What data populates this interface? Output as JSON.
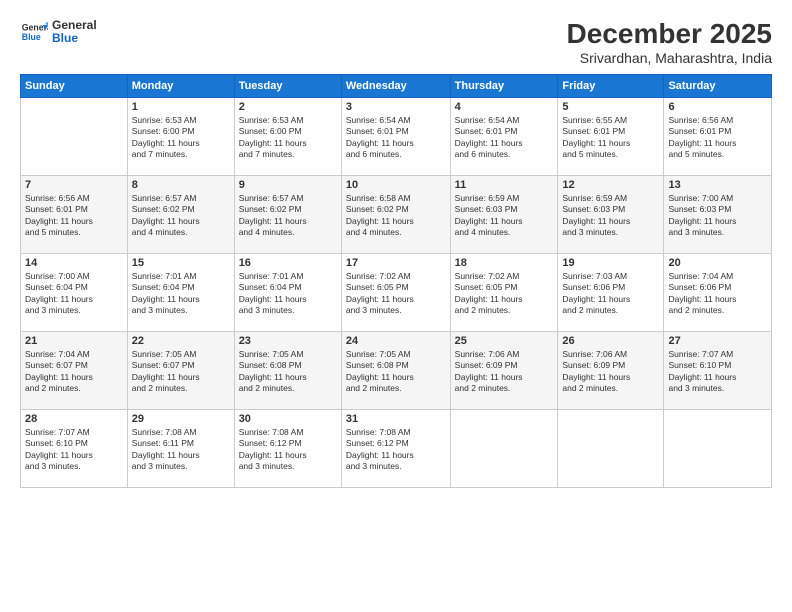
{
  "logo": {
    "line1": "General",
    "line2": "Blue"
  },
  "title": "December 2025",
  "subtitle": "Srivardhan, Maharashtra, India",
  "days_of_week": [
    "Sunday",
    "Monday",
    "Tuesday",
    "Wednesday",
    "Thursday",
    "Friday",
    "Saturday"
  ],
  "weeks": [
    [
      {
        "day": "",
        "info": ""
      },
      {
        "day": "1",
        "info": "Sunrise: 6:53 AM\nSunset: 6:00 PM\nDaylight: 11 hours\nand 7 minutes."
      },
      {
        "day": "2",
        "info": "Sunrise: 6:53 AM\nSunset: 6:00 PM\nDaylight: 11 hours\nand 7 minutes."
      },
      {
        "day": "3",
        "info": "Sunrise: 6:54 AM\nSunset: 6:01 PM\nDaylight: 11 hours\nand 6 minutes."
      },
      {
        "day": "4",
        "info": "Sunrise: 6:54 AM\nSunset: 6:01 PM\nDaylight: 11 hours\nand 6 minutes."
      },
      {
        "day": "5",
        "info": "Sunrise: 6:55 AM\nSunset: 6:01 PM\nDaylight: 11 hours\nand 5 minutes."
      },
      {
        "day": "6",
        "info": "Sunrise: 6:56 AM\nSunset: 6:01 PM\nDaylight: 11 hours\nand 5 minutes."
      }
    ],
    [
      {
        "day": "7",
        "info": "Sunrise: 6:56 AM\nSunset: 6:01 PM\nDaylight: 11 hours\nand 5 minutes."
      },
      {
        "day": "8",
        "info": "Sunrise: 6:57 AM\nSunset: 6:02 PM\nDaylight: 11 hours\nand 4 minutes."
      },
      {
        "day": "9",
        "info": "Sunrise: 6:57 AM\nSunset: 6:02 PM\nDaylight: 11 hours\nand 4 minutes."
      },
      {
        "day": "10",
        "info": "Sunrise: 6:58 AM\nSunset: 6:02 PM\nDaylight: 11 hours\nand 4 minutes."
      },
      {
        "day": "11",
        "info": "Sunrise: 6:59 AM\nSunset: 6:03 PM\nDaylight: 11 hours\nand 4 minutes."
      },
      {
        "day": "12",
        "info": "Sunrise: 6:59 AM\nSunset: 6:03 PM\nDaylight: 11 hours\nand 3 minutes."
      },
      {
        "day": "13",
        "info": "Sunrise: 7:00 AM\nSunset: 6:03 PM\nDaylight: 11 hours\nand 3 minutes."
      }
    ],
    [
      {
        "day": "14",
        "info": "Sunrise: 7:00 AM\nSunset: 6:04 PM\nDaylight: 11 hours\nand 3 minutes."
      },
      {
        "day": "15",
        "info": "Sunrise: 7:01 AM\nSunset: 6:04 PM\nDaylight: 11 hours\nand 3 minutes."
      },
      {
        "day": "16",
        "info": "Sunrise: 7:01 AM\nSunset: 6:04 PM\nDaylight: 11 hours\nand 3 minutes."
      },
      {
        "day": "17",
        "info": "Sunrise: 7:02 AM\nSunset: 6:05 PM\nDaylight: 11 hours\nand 3 minutes."
      },
      {
        "day": "18",
        "info": "Sunrise: 7:02 AM\nSunset: 6:05 PM\nDaylight: 11 hours\nand 2 minutes."
      },
      {
        "day": "19",
        "info": "Sunrise: 7:03 AM\nSunset: 6:06 PM\nDaylight: 11 hours\nand 2 minutes."
      },
      {
        "day": "20",
        "info": "Sunrise: 7:04 AM\nSunset: 6:06 PM\nDaylight: 11 hours\nand 2 minutes."
      }
    ],
    [
      {
        "day": "21",
        "info": "Sunrise: 7:04 AM\nSunset: 6:07 PM\nDaylight: 11 hours\nand 2 minutes."
      },
      {
        "day": "22",
        "info": "Sunrise: 7:05 AM\nSunset: 6:07 PM\nDaylight: 11 hours\nand 2 minutes."
      },
      {
        "day": "23",
        "info": "Sunrise: 7:05 AM\nSunset: 6:08 PM\nDaylight: 11 hours\nand 2 minutes."
      },
      {
        "day": "24",
        "info": "Sunrise: 7:05 AM\nSunset: 6:08 PM\nDaylight: 11 hours\nand 2 minutes."
      },
      {
        "day": "25",
        "info": "Sunrise: 7:06 AM\nSunset: 6:09 PM\nDaylight: 11 hours\nand 2 minutes."
      },
      {
        "day": "26",
        "info": "Sunrise: 7:06 AM\nSunset: 6:09 PM\nDaylight: 11 hours\nand 2 minutes."
      },
      {
        "day": "27",
        "info": "Sunrise: 7:07 AM\nSunset: 6:10 PM\nDaylight: 11 hours\nand 3 minutes."
      }
    ],
    [
      {
        "day": "28",
        "info": "Sunrise: 7:07 AM\nSunset: 6:10 PM\nDaylight: 11 hours\nand 3 minutes."
      },
      {
        "day": "29",
        "info": "Sunrise: 7:08 AM\nSunset: 6:11 PM\nDaylight: 11 hours\nand 3 minutes."
      },
      {
        "day": "30",
        "info": "Sunrise: 7:08 AM\nSunset: 6:12 PM\nDaylight: 11 hours\nand 3 minutes."
      },
      {
        "day": "31",
        "info": "Sunrise: 7:08 AM\nSunset: 6:12 PM\nDaylight: 11 hours\nand 3 minutes."
      },
      {
        "day": "",
        "info": ""
      },
      {
        "day": "",
        "info": ""
      },
      {
        "day": "",
        "info": ""
      }
    ]
  ]
}
